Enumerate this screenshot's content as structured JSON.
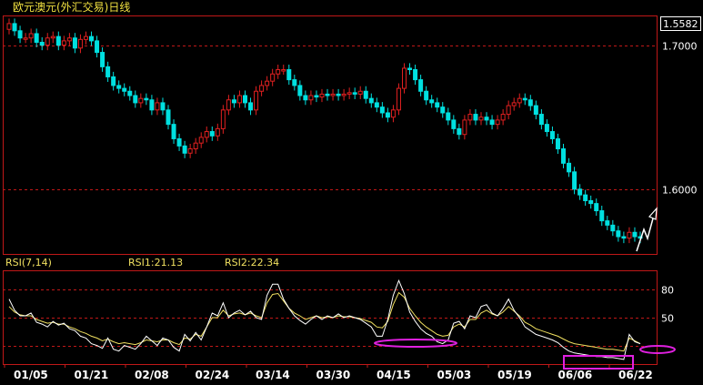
{
  "header": {
    "title": "欧元澳元(外汇交易)日线",
    "current_price": "1.5582"
  },
  "rsi_panel": {
    "indicator": "RSI(7,14)",
    "rsi1": "RSI1:21.13",
    "rsi2": "RSI2:22.34"
  },
  "colors": {
    "background": "#000000",
    "up_candle": "#e02020",
    "down_candle": "#00e0e0",
    "grid": "#c01818",
    "rsi1_line": "#ffffff",
    "rsi2_line": "#f0e060",
    "highlight": "#e020e0",
    "forecast_arrow": "#ffffff"
  },
  "chart_data": [
    {
      "type": "candlestick",
      "y_ticks": [
        "1.7000",
        "1.6000"
      ],
      "y_range": [
        1.555,
        1.72
      ],
      "x_tick_labels": [
        "01/05",
        "01/21",
        "02/08",
        "02/24",
        "03/14",
        "03/30",
        "04/15",
        "05/03",
        "05/19",
        "06/06",
        "06/22"
      ],
      "close": [
        1.715,
        1.71,
        1.705,
        1.705,
        1.708,
        1.702,
        1.7,
        1.705,
        1.706,
        1.7,
        1.703,
        1.705,
        1.698,
        1.704,
        1.706,
        1.703,
        1.695,
        1.685,
        1.678,
        1.672,
        1.67,
        1.668,
        1.665,
        1.66,
        1.663,
        1.662,
        1.655,
        1.66,
        1.655,
        1.645,
        1.635,
        1.63,
        1.625,
        1.628,
        1.632,
        1.636,
        1.64,
        1.637,
        1.642,
        1.655,
        1.662,
        1.66,
        1.665,
        1.66,
        1.655,
        1.668,
        1.672,
        1.675,
        1.68,
        1.683,
        1.683,
        1.676,
        1.672,
        1.665,
        1.662,
        1.665,
        1.664,
        1.666,
        1.665,
        1.666,
        1.665,
        1.666,
        1.667,
        1.666,
        1.668,
        1.663,
        1.66,
        1.657,
        1.653,
        1.65,
        1.655,
        1.67,
        1.684,
        1.683,
        1.676,
        1.668,
        1.662,
        1.66,
        1.657,
        1.653,
        1.648,
        1.642,
        1.638,
        1.648,
        1.652,
        1.648,
        1.65,
        1.648,
        1.645,
        1.648,
        1.652,
        1.658,
        1.66,
        1.663,
        1.662,
        1.658,
        1.652,
        1.645,
        1.64,
        1.635,
        1.628,
        1.618,
        1.612,
        1.6,
        1.596,
        1.592,
        1.59,
        1.585,
        1.578,
        1.575,
        1.571,
        1.567,
        1.566,
        1.57,
        1.567,
        1.566
      ],
      "rsi_scale": [
        0,
        100
      ],
      "rsi_ticks": [
        "80",
        "50"
      ],
      "rsi1": [
        70,
        58,
        52,
        52,
        55,
        45,
        43,
        40,
        46,
        42,
        44,
        38,
        36,
        30,
        28,
        22,
        20,
        17,
        28,
        16,
        14,
        20,
        18,
        16,
        22,
        30,
        25,
        20,
        28,
        26,
        18,
        14,
        32,
        25,
        34,
        26,
        40,
        55,
        52,
        66,
        50,
        55,
        58,
        53,
        57,
        50,
        48,
        74,
        86,
        86,
        70,
        60,
        52,
        47,
        43,
        48,
        52,
        48,
        52,
        50,
        54,
        50,
        52,
        50,
        48,
        44,
        40,
        30,
        30,
        48,
        74,
        90,
        76,
        56,
        46,
        38,
        33,
        30,
        24,
        22,
        26,
        44,
        46,
        38,
        52,
        50,
        62,
        64,
        55,
        52,
        60,
        70,
        58,
        50,
        40,
        36,
        32,
        30,
        28,
        26,
        23,
        18,
        14,
        12,
        11,
        10,
        9,
        8,
        8,
        7,
        7,
        6,
        5,
        32,
        24,
        22
      ],
      "rsi2": [
        62,
        56,
        53,
        52,
        52,
        48,
        46,
        44,
        45,
        43,
        43,
        40,
        38,
        35,
        33,
        30,
        28,
        25,
        27,
        24,
        22,
        23,
        22,
        21,
        23,
        26,
        25,
        24,
        26,
        26,
        23,
        21,
        28,
        27,
        32,
        30,
        40,
        50,
        50,
        58,
        52,
        54,
        55,
        53,
        55,
        52,
        50,
        66,
        75,
        76,
        68,
        60,
        55,
        52,
        48,
        50,
        52,
        50,
        51,
        50,
        52,
        51,
        51,
        50,
        49,
        47,
        45,
        40,
        39,
        46,
        64,
        77,
        72,
        60,
        52,
        45,
        40,
        36,
        32,
        30,
        31,
        40,
        43,
        40,
        48,
        48,
        55,
        58,
        54,
        52,
        56,
        62,
        57,
        52,
        45,
        42,
        38,
        36,
        34,
        32,
        30,
        27,
        24,
        22,
        21,
        20,
        19,
        18,
        17,
        16,
        16,
        15,
        14,
        28,
        25,
        22
      ]
    }
  ]
}
